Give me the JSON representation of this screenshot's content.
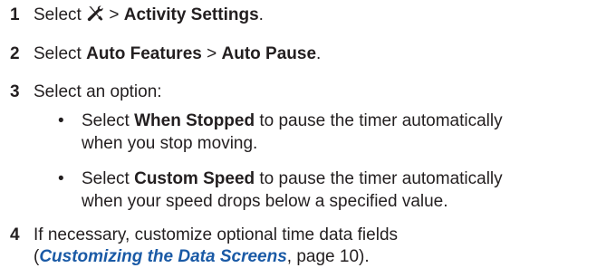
{
  "steps": [
    {
      "number": "1",
      "prefix": "Select",
      "icon": "wrench-screwdriver-icon",
      "separator": ">",
      "target": "Activity Settings",
      "suffix": "."
    },
    {
      "number": "2",
      "prefix": "Select",
      "menu": "Auto Features",
      "separator": ">",
      "target": "Auto Pause",
      "suffix": "."
    },
    {
      "number": "3",
      "text": "Select an option:",
      "options": [
        {
          "bullet": "•",
          "prefix": "Select",
          "name": "When Stopped",
          "line1_rest": "to pause the timer automatically",
          "line2": "when you stop moving."
        },
        {
          "bullet": "•",
          "prefix": "Select",
          "name": "Custom Speed",
          "line1_rest": "to pause the timer automatically",
          "line2": "when your speed drops below a specified value."
        }
      ]
    },
    {
      "number": "4",
      "line1": "If necessary, customize optional time data fields",
      "open_paren": "(",
      "link_text": "Customizing the Data Screens",
      "page_ref": ", page 10",
      "close": ")."
    }
  ],
  "colors": {
    "text": "#231f20",
    "link": "#1a5aa6"
  }
}
